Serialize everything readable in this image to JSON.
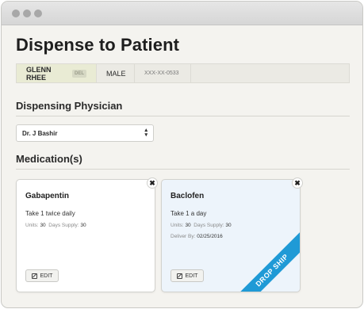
{
  "page": {
    "title": "Dispense to Patient"
  },
  "patient": {
    "name": "GLENN RHEE",
    "badge": "DEL",
    "gender": "MALE",
    "ssn": "XXX-XX-0533"
  },
  "physician": {
    "heading": "Dispensing Physician",
    "selected": "Dr. J Bashir"
  },
  "medications": {
    "heading": "Medication(s)",
    "items": [
      {
        "name": "Gabapentin",
        "instructions": "Take 1 twice daily",
        "units_label": "Units:",
        "units": "30",
        "supply_label": "Days Supply:",
        "supply": "30",
        "edit_label": "EDIT"
      },
      {
        "name": "Baclofen",
        "instructions": "Take 1 a day",
        "units_label": "Units:",
        "units": "30",
        "supply_label": "Days Supply:",
        "supply": "30",
        "deliver_label": "Deliver By:",
        "deliver": "02/25/2016",
        "edit_label": "EDIT",
        "ribbon": "DROP SHIP"
      }
    ]
  },
  "icons": {
    "remove": "✖",
    "select": "▲▼"
  },
  "colors": {
    "ribbon": "#1f9ad6",
    "drop_ship_card": "#edf4fb",
    "patient_name_bg": "#e9ebd4"
  }
}
